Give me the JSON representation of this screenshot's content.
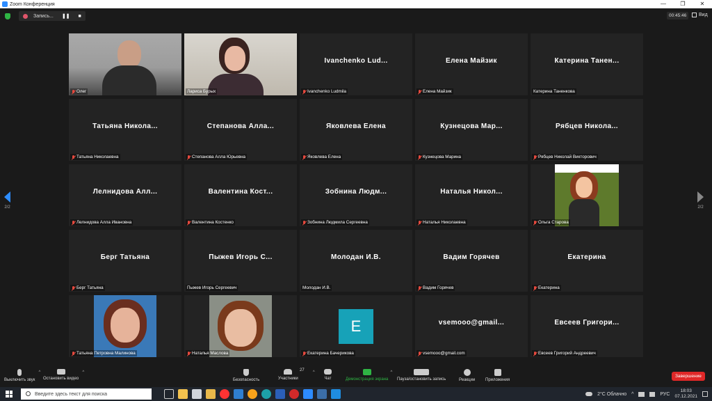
{
  "window": {
    "title": "Zoom Конференция",
    "minimize": "—",
    "maximize": "❐",
    "close": "✕"
  },
  "topbar": {
    "recording_label": "Запись...",
    "pause_glyph": "❚❚",
    "stop_glyph": "■",
    "timer": "00:45:46",
    "view_label": "Вид"
  },
  "colors": {
    "active_speaker": "#e9f05c",
    "accent": "#2d8cff",
    "end_button": "#e02828",
    "muted_mic": "#e6493e",
    "avatar_e": "#17a2b8"
  },
  "participants": [
    {
      "big": "",
      "label": "Олег",
      "muted": true,
      "video": "photo-olig",
      "active": false
    },
    {
      "big": "",
      "label": "Лариса Бурых",
      "muted": false,
      "video": "photo-larisa",
      "active": true
    },
    {
      "big": "Ivanchenko Lud...",
      "label": "Ivanchenko Ludmila",
      "muted": true
    },
    {
      "big": "Елена Майзик",
      "label": "Елена Майзик",
      "muted": true
    },
    {
      "big": "Катерина Танен...",
      "label": "Катерина Таненкова",
      "muted": false
    },
    {
      "big": "Татьяна Никола...",
      "label": "Татьяна Николаевна",
      "muted": true
    },
    {
      "big": "Степанова Алла...",
      "label": "Степанова Алла Юрьевна",
      "muted": true
    },
    {
      "big": "Яковлева Елена",
      "label": "Яковлева Елена",
      "muted": true
    },
    {
      "big": "Кузнецова Мар...",
      "label": "Кузнецова Марина",
      "muted": true
    },
    {
      "big": "Рябцев Никола...",
      "label": "Рябцев Николай Викторович",
      "muted": true
    },
    {
      "big": "Лелнидова Алл...",
      "label": "Лелнидова Алла Ивановна",
      "muted": true
    },
    {
      "big": "Валентина Кост...",
      "label": "Валентина Костенко",
      "muted": true
    },
    {
      "big": "Зобнина Людм...",
      "label": "Зобнина Людмила Сергеевна",
      "muted": true
    },
    {
      "big": "Наталья Никол...",
      "label": "Наталья Николаевна",
      "muted": true
    },
    {
      "big": "",
      "label": "Ольга Старова",
      "muted": true,
      "video": "photo-teacher"
    },
    {
      "big": "Берг Татьяна",
      "label": "Берг Татьяна",
      "muted": true
    },
    {
      "big": "Пыжев Игорь С...",
      "label": "Пыжев Игорь Сергеевич",
      "muted": false
    },
    {
      "big": "Молодан И.В.",
      "label": "Молодан И.В.",
      "muted": false
    },
    {
      "big": "Вадим Горячев",
      "label": "Вадим Горячев",
      "muted": true
    },
    {
      "big": "Екатерина",
      "label": "Екатерина",
      "muted": true
    },
    {
      "big": "",
      "label": "Татьяна Петровна Малинова",
      "muted": true,
      "video": "photo-tatyana"
    },
    {
      "big": "",
      "label": "Наталья Маслова",
      "muted": true,
      "video": "photo-natalya"
    },
    {
      "big": "",
      "label": "Екатерина Бачерикова",
      "muted": true,
      "avatar": "E"
    },
    {
      "big": "vsemooo@gmail...",
      "label": "vsemooo@gmail.com",
      "muted": true
    },
    {
      "big": "Евсеев Григори...",
      "label": "Евсеев Григорий Андреевич",
      "muted": true
    }
  ],
  "paging": {
    "left": "2/2",
    "right": "2/2"
  },
  "toolbar": {
    "mute": "Выключить звук",
    "video": "Остановить видео",
    "security": "Безопасность",
    "participants": "Участники",
    "participants_count": "27",
    "chat": "Чат",
    "share": "Демонстрация экрана",
    "pause_rec": "Пауза/остановить запись",
    "reactions": "Реакции",
    "apps": "Приложения",
    "end": "Завершение"
  },
  "taskbar": {
    "search_placeholder": "Введите здесь текст для поиска",
    "weather": "2°C Облачно",
    "lang": "РУС",
    "time": "18:03",
    "date": "07.12.2021"
  }
}
